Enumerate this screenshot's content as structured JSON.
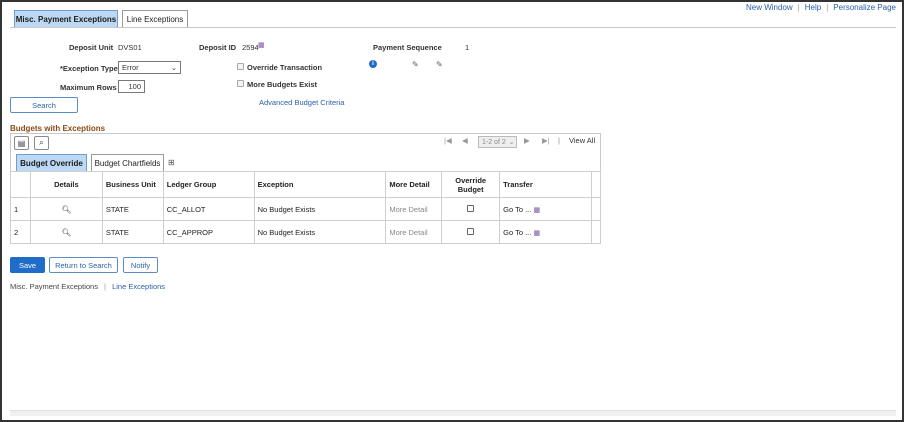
{
  "tabs": [
    {
      "label": "Misc. Payment Exceptions",
      "active": true
    },
    {
      "label": "Line Exceptions",
      "active": false
    }
  ],
  "top_links": {
    "new_window": "New Window",
    "help": "Help",
    "personalize": "Personalize Page"
  },
  "header": {
    "deposit_unit_label": "Deposit Unit",
    "deposit_unit_value": "DVS01",
    "deposit_id_label": "Deposit ID",
    "deposit_id_value": "2594",
    "payment_sequence_label": "Payment Sequence",
    "payment_sequence_value": "1"
  },
  "form": {
    "exception_type_label": "*Exception Type",
    "exception_type_value": "Error",
    "max_rows_label": "Maximum Rows",
    "max_rows_value": "100",
    "override_transaction_label": "Override Transaction",
    "more_budgets_label": "More Budgets Exist",
    "advanced_budget_link": "Advanced Budget Criteria",
    "search_label": "Search"
  },
  "grid": {
    "title": "Budgets with Exceptions",
    "pager_text": "1-2 of 2",
    "view_all": "View All",
    "subtabs": [
      {
        "label": "Budget Override",
        "active": true
      },
      {
        "label": "Budget Chartfields",
        "active": false
      }
    ],
    "columns": [
      "Details",
      "Business Unit",
      "Ledger Group",
      "Exception",
      "More Detail",
      "Override Budget",
      "Transfer"
    ],
    "rows": [
      {
        "num": "1",
        "business_unit": "STATE",
        "ledger_group": "CC_ALLOT",
        "exception": "No Budget Exists",
        "more_detail": "More Detail",
        "transfer": "Go To ..."
      },
      {
        "num": "2",
        "business_unit": "STATE",
        "ledger_group": "CC_APPROP",
        "exception": "No Budget Exists",
        "more_detail": "More Detail",
        "transfer": "Go To ..."
      }
    ]
  },
  "buttons": {
    "save": "Save",
    "return_to_search": "Return to Search",
    "notify": "Notify"
  },
  "footer": {
    "link1": "Misc. Payment Exceptions",
    "link2": "Line Exceptions"
  },
  "colors": {
    "accent": "#1f6cc9",
    "section_title": "#8b4a16",
    "tab_active": "#bcd8f2"
  }
}
